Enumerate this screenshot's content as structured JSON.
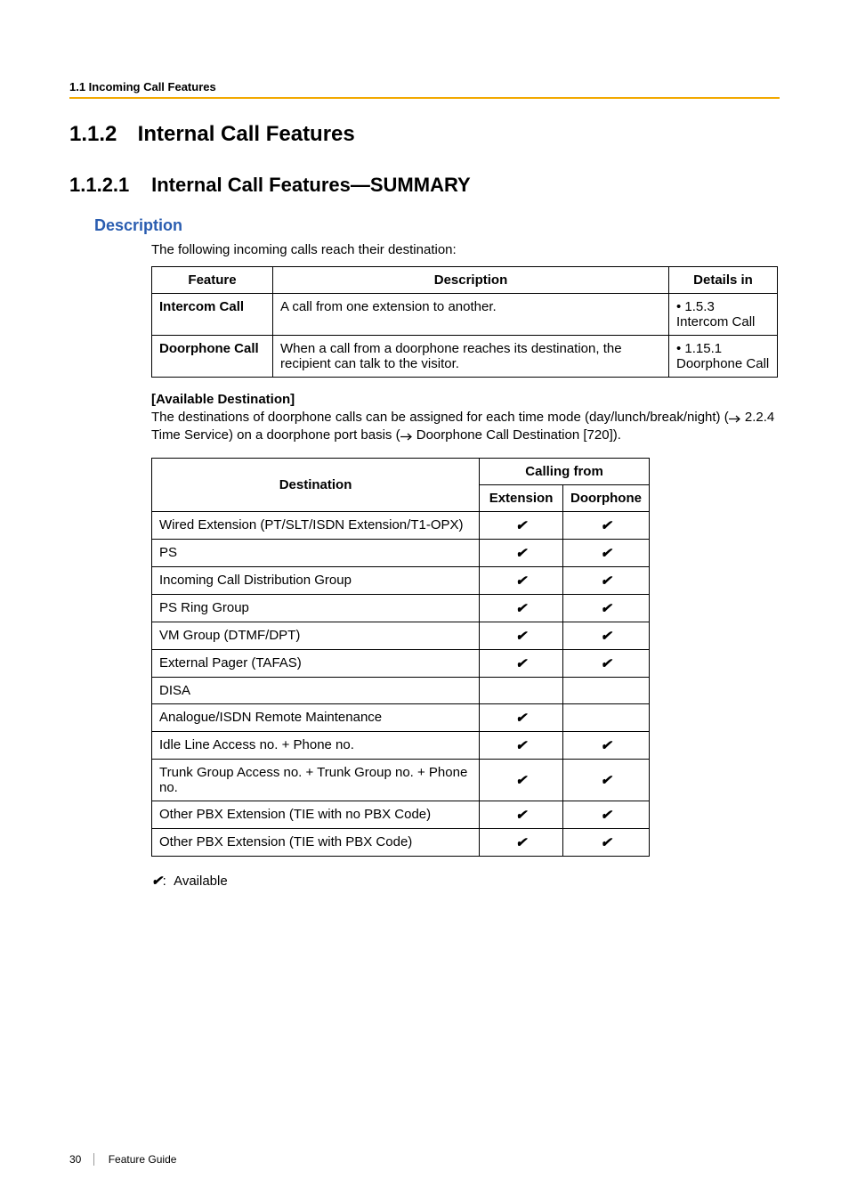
{
  "header": {
    "running": "1.1 Incoming Call Features"
  },
  "section": {
    "number": "1.1.2",
    "title": "Internal Call Features"
  },
  "subsection": {
    "number": "1.1.2.1",
    "title": "Internal Call Features—SUMMARY"
  },
  "description": {
    "heading": "Description",
    "intro": "The following incoming calls reach their destination:",
    "table1": {
      "headers": [
        "Feature",
        "Description",
        "Details in"
      ],
      "rows": [
        {
          "feature": "Intercom Call",
          "desc": "A call from one extension to another.",
          "detail_bullet": "• 1.5.3 Intercom Call"
        },
        {
          "feature": "Doorphone Call",
          "desc": "When a call from a doorphone reaches its destination, the recipient can talk to the visitor.",
          "detail_bullet": "• 1.15.1 Doorphone Call"
        }
      ]
    },
    "avail_dest": {
      "title": "[Available Destination]",
      "text_pre": "The destinations of doorphone calls can be assigned for each time mode (day/lunch/break/night) (",
      "text_link1": " 2.2.4 Time Service",
      "text_mid": ") on a doorphone port basis (",
      "text_link2": " Doorphone Call Destination [720]",
      "text_post": ").",
      "table_head": {
        "dest": "Destination",
        "calling_from": "Calling from",
        "ext": "Extension",
        "door": "Doorphone"
      },
      "rows": [
        {
          "dest": "Wired Extension (PT/SLT/ISDN Extension/T1-OPX)",
          "ext": true,
          "door": true
        },
        {
          "dest": "PS",
          "ext": true,
          "door": true
        },
        {
          "dest": "Incoming Call Distribution Group",
          "ext": true,
          "door": true
        },
        {
          "dest": "PS Ring Group",
          "ext": true,
          "door": true
        },
        {
          "dest": "VM Group (DTMF/DPT)",
          "ext": true,
          "door": true
        },
        {
          "dest": "External Pager (TAFAS)",
          "ext": true,
          "door": true
        },
        {
          "dest": "DISA",
          "ext": false,
          "door": false
        },
        {
          "dest": "Analogue/ISDN Remote Maintenance",
          "ext": true,
          "door": false
        },
        {
          "dest": "Idle Line Access no. + Phone no.",
          "ext": true,
          "door": true
        },
        {
          "dest": "Trunk Group Access no. + Trunk Group no. + Phone no.",
          "ext": true,
          "door": true
        },
        {
          "dest": "Other PBX Extension (TIE with no PBX Code)",
          "ext": true,
          "door": true
        },
        {
          "dest": "Other PBX Extension (TIE with PBX Code)",
          "ext": true,
          "door": true
        }
      ]
    },
    "legend_suffix": ":",
    "legend": "Available"
  },
  "footer": {
    "page": "30",
    "title": "Feature Guide"
  },
  "glyphs": {
    "check": "✔"
  }
}
